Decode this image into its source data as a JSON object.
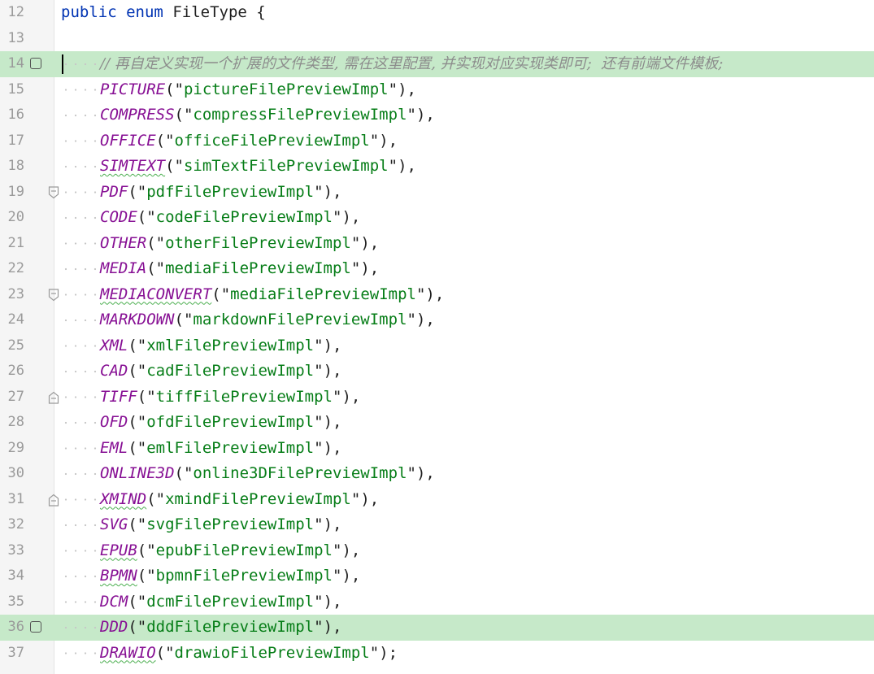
{
  "editor": {
    "header_line": {
      "number": "12",
      "keyword1": "public",
      "keyword2": "enum",
      "name": "FileType",
      "brace": "{"
    },
    "blank_line": {
      "number": "13"
    },
    "comment_line": {
      "number": "14",
      "text": "// 再自定义实现一个扩展的文件类型, 需在这里配置, 并实现对应实现类即可;  还有前端文件模板;"
    },
    "entries": [
      {
        "number": "15",
        "name": "PICTURE",
        "value": "pictureFilePreviewImpl",
        "end": "),"
      },
      {
        "number": "16",
        "name": "COMPRESS",
        "value": "compressFilePreviewImpl",
        "end": "),"
      },
      {
        "number": "17",
        "name": "OFFICE",
        "value": "officeFilePreviewImpl",
        "end": "),"
      },
      {
        "number": "18",
        "name": "SIMTEXT",
        "value": "simTextFilePreviewImpl",
        "end": "),"
      },
      {
        "number": "19",
        "name": "PDF",
        "value": "pdfFilePreviewImpl",
        "end": "),"
      },
      {
        "number": "20",
        "name": "CODE",
        "value": "codeFilePreviewImpl",
        "end": "),"
      },
      {
        "number": "21",
        "name": "OTHER",
        "value": "otherFilePreviewImpl",
        "end": "),"
      },
      {
        "number": "22",
        "name": "MEDIA",
        "value": "mediaFilePreviewImpl",
        "end": "),"
      },
      {
        "number": "23",
        "name": "MEDIACONVERT",
        "value": "mediaFilePreviewImpl",
        "end": "),"
      },
      {
        "number": "24",
        "name": "MARKDOWN",
        "value": "markdownFilePreviewImpl",
        "end": "),"
      },
      {
        "number": "25",
        "name": "XML",
        "value": "xmlFilePreviewImpl",
        "end": "),"
      },
      {
        "number": "26",
        "name": "CAD",
        "value": "cadFilePreviewImpl",
        "end": "),"
      },
      {
        "number": "27",
        "name": "TIFF",
        "value": "tiffFilePreviewImpl",
        "end": "),"
      },
      {
        "number": "28",
        "name": "OFD",
        "value": "ofdFilePreviewImpl",
        "end": "),"
      },
      {
        "number": "29",
        "name": "EML",
        "value": "emlFilePreviewImpl",
        "end": "),"
      },
      {
        "number": "30",
        "name": "ONLINE3D",
        "value": "online3DFilePreviewImpl",
        "end": "),"
      },
      {
        "number": "31",
        "name": "XMIND",
        "value": "xmindFilePreviewImpl",
        "end": "),"
      },
      {
        "number": "32",
        "name": "SVG",
        "value": "svgFilePreviewImpl",
        "end": "),"
      },
      {
        "number": "33",
        "name": "EPUB",
        "value": "epubFilePreviewImpl",
        "end": "),"
      },
      {
        "number": "34",
        "name": "BPMN",
        "value": "bpmnFilePreviewImpl",
        "end": "),"
      },
      {
        "number": "35",
        "name": "DCM",
        "value": "dcmFilePreviewImpl",
        "end": "),"
      },
      {
        "number": "36",
        "name": "DDD",
        "value": "dddFilePreviewImpl",
        "end": "),"
      },
      {
        "number": "37",
        "name": "DRAWIO",
        "value": "drawioFilePreviewImpl",
        "end": ");"
      }
    ],
    "gutter_icons": {
      "bookmark_lines": [
        "14",
        "36"
      ],
      "fold_lines": [
        "19",
        "23",
        "27",
        "31"
      ]
    },
    "colors": {
      "keyword": "#0033b3",
      "constant": "#871094",
      "string": "#067d17",
      "comment": "#8c8c8c",
      "highlight": "#c6e9c9"
    }
  }
}
